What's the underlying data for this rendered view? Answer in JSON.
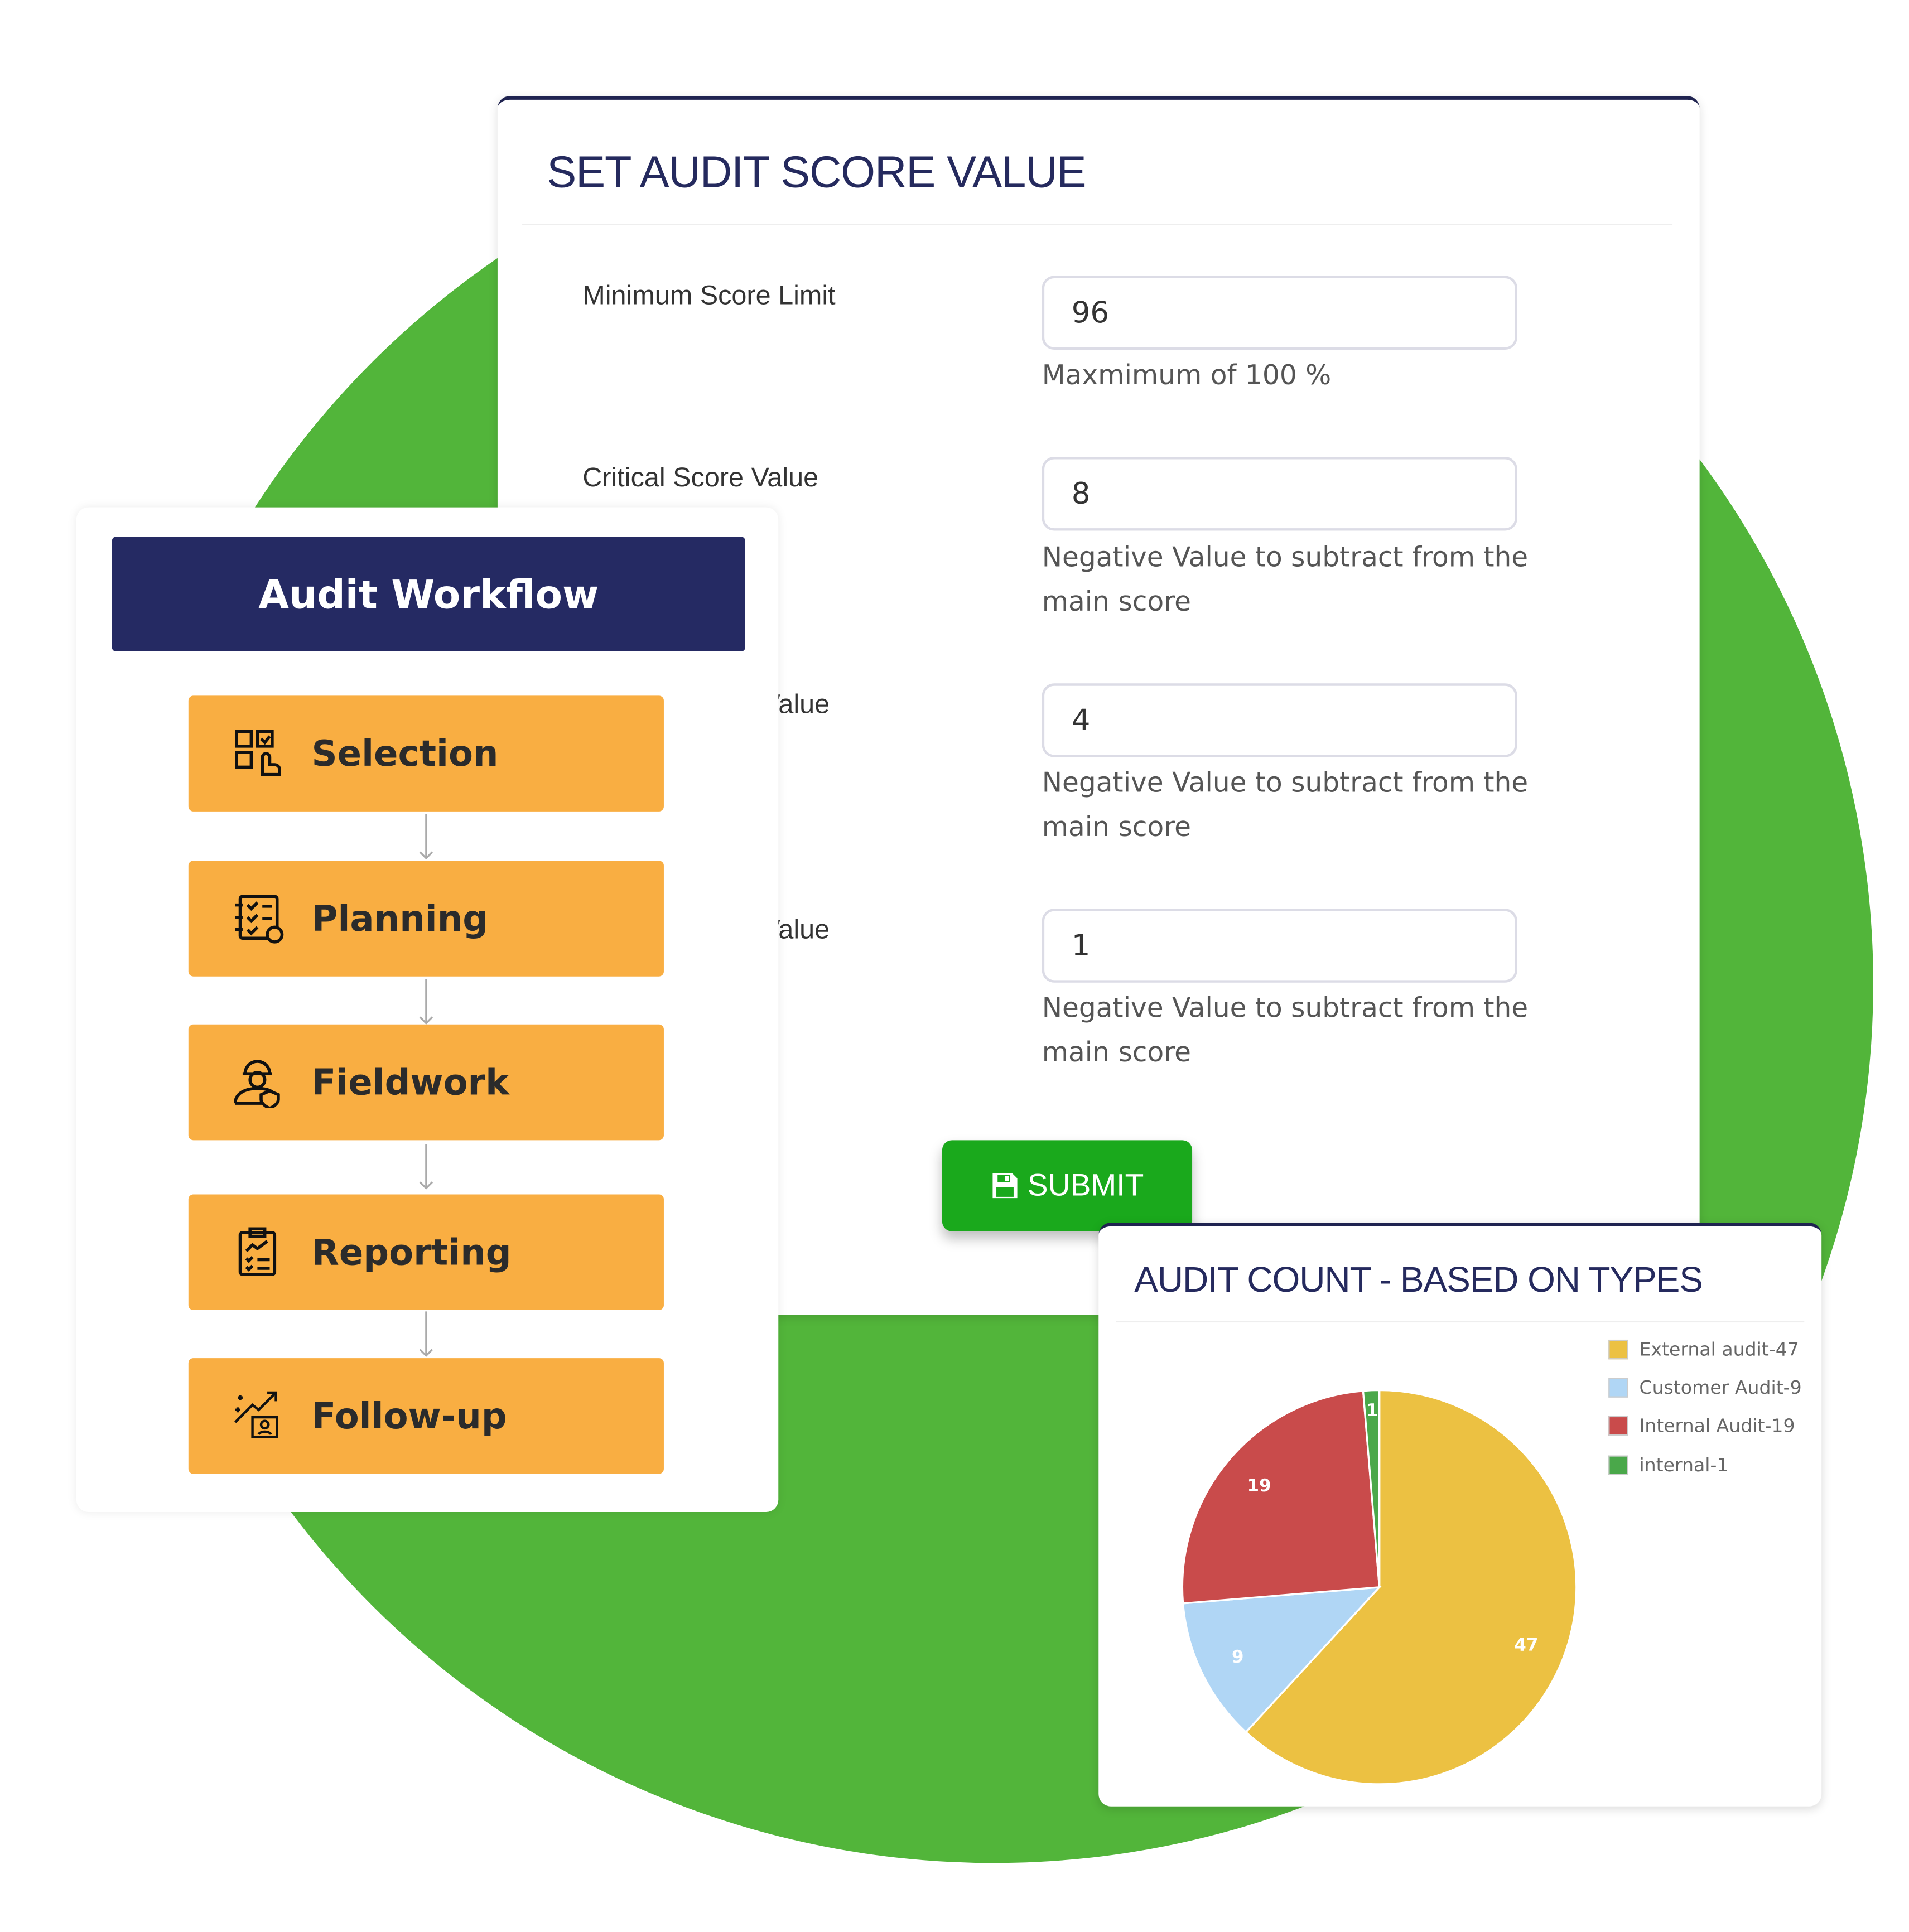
{
  "colors": {
    "green_bg": "#52b53a",
    "navy": "#252a63",
    "orange": "#f9ae42",
    "submit": "#1aa91c"
  },
  "score_panel": {
    "title": "SET AUDIT SCORE VALUE",
    "rows": [
      {
        "label": "Minimum Score Limit",
        "value": "96",
        "help": "Maxmimum of 100 %"
      },
      {
        "label": "Critical Score Value",
        "value": "8",
        "help": "Negative Value to subtract from the main score"
      },
      {
        "label": "Value",
        "value": "4",
        "help": "Negative Value to subtract from the main score"
      },
      {
        "label": "Value",
        "value": "1",
        "help": "Negative Value to subtract from the main score"
      }
    ],
    "submit_label": "SUBMIT",
    "submit_icon": "floppy-disk-icon"
  },
  "workflow": {
    "title": "Audit Workflow",
    "steps": [
      {
        "label": "Selection",
        "icon": "selection-icon"
      },
      {
        "label": "Planning",
        "icon": "checklist-icon"
      },
      {
        "label": "Fieldwork",
        "icon": "worker-icon"
      },
      {
        "label": "Reporting",
        "icon": "clipboard-chart-icon"
      },
      {
        "label": "Follow-up",
        "icon": "growth-icon"
      }
    ]
  },
  "chart_data": {
    "type": "pie",
    "title": "AUDIT COUNT - BASED ON TYPES",
    "categories": [
      "External audit",
      "Customer Audit",
      "Internal Audit",
      "internal"
    ],
    "values": [
      47,
      9,
      19,
      1
    ],
    "legend_labels": [
      "External audit-47",
      "Customer Audit-9",
      "Internal Audit-19",
      "internal-1"
    ],
    "colors": [
      "#ecc142",
      "#b0d6f5",
      "#c94b4b",
      "#4aa84a"
    ],
    "legend": "top-right",
    "start": "top, clockwise"
  }
}
